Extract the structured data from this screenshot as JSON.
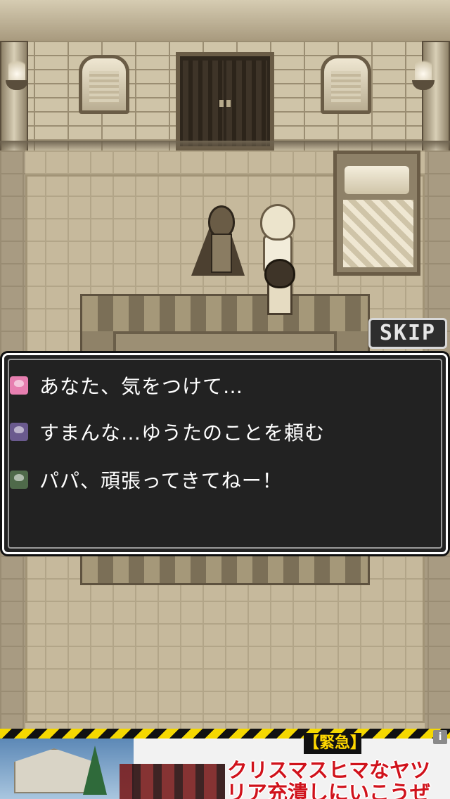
{
  "scene": {
    "palette": {
      "sepia_light": "#cfc4a8",
      "sepia_dark": "#4a3e2e",
      "floor": "#c6b99c"
    }
  },
  "skip_button": {
    "label": "SKIP"
  },
  "dialogue": {
    "lines": [
      {
        "speaker_icon": "pink-haired-woman-icon",
        "icon_color": "#e77fb0",
        "text": "あなた、気をつけて…"
      },
      {
        "speaker_icon": "crowned-hero-icon",
        "icon_color": "#6a5a8e",
        "text": "すまんな…ゆうたのことを頼む"
      },
      {
        "speaker_icon": "dark-haired-child-icon",
        "icon_color": "#4f6a4a",
        "text": "パパ、頑張ってきてねー！"
      }
    ]
  },
  "ad_banner": {
    "tag": "【緊急】",
    "headline_line1": "クリスマスヒマなヤツ",
    "headline_line2": "リア充潰しにいこうぜ",
    "info_icon_label": "i"
  }
}
